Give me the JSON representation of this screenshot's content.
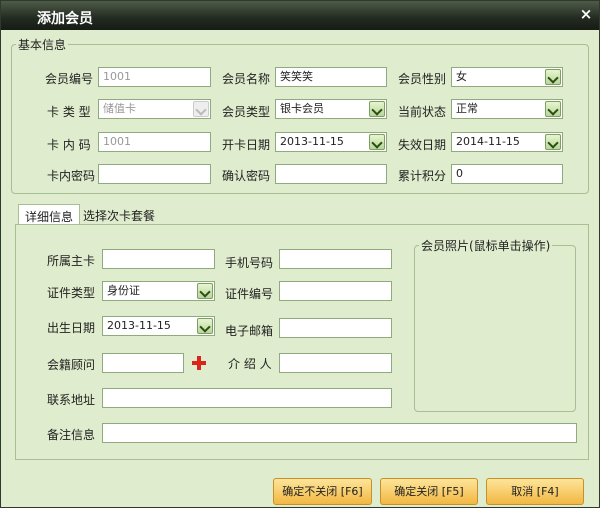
{
  "window": {
    "title": "添加会员",
    "close_glyph": "×"
  },
  "basic": {
    "legend": "基本信息",
    "member_no": {
      "label": "会员编号",
      "value": "1001"
    },
    "member_name": {
      "label": "会员名称",
      "value": "笑笑笑"
    },
    "gender": {
      "label": "会员性别",
      "value": "女"
    },
    "card_type": {
      "label": "卡 类 型",
      "value": "储值卡"
    },
    "member_type": {
      "label": "会员类型",
      "value": "银卡会员"
    },
    "status": {
      "label": "当前状态",
      "value": "正常"
    },
    "card_code": {
      "label": "卡 内 码",
      "value": "1001"
    },
    "open_date": {
      "label": "开卡日期",
      "value": "2013-11-15"
    },
    "expire_date": {
      "label": "失效日期",
      "value": "2014-11-15"
    },
    "card_password": {
      "label": "卡内密码",
      "value": ""
    },
    "confirm_password": {
      "label": "确认密码",
      "value": ""
    },
    "points": {
      "label": "累计积分",
      "value": "0"
    }
  },
  "tabs": [
    {
      "label": "详细信息",
      "active": true
    },
    {
      "label": "选择次卡套餐",
      "active": false
    }
  ],
  "detail": {
    "main_card": {
      "label": "所属主卡",
      "value": ""
    },
    "phone": {
      "label": "手机号码",
      "value": ""
    },
    "id_type": {
      "label": "证件类型",
      "value": "身份证"
    },
    "id_no": {
      "label": "证件编号",
      "value": ""
    },
    "birth_date": {
      "label": "出生日期",
      "value": "2013-11-15"
    },
    "email": {
      "label": "电子邮箱",
      "value": ""
    },
    "advisor": {
      "label": "会籍顾问",
      "value": ""
    },
    "referrer": {
      "label": "介 绍 人",
      "value": ""
    },
    "address": {
      "label": "联系地址",
      "value": ""
    },
    "remark": {
      "label": "备注信息",
      "value": ""
    },
    "photo_legend": "会员照片(鼠标单击操作)"
  },
  "buttons": {
    "ok_keep": "确定不关闭 [F6]",
    "ok_close": "确定关闭 [F5]",
    "cancel": "取消 [F4]"
  },
  "icons": {
    "add": "plus-icon",
    "dropdown": "chevron-down-icon",
    "close": "close-icon"
  }
}
